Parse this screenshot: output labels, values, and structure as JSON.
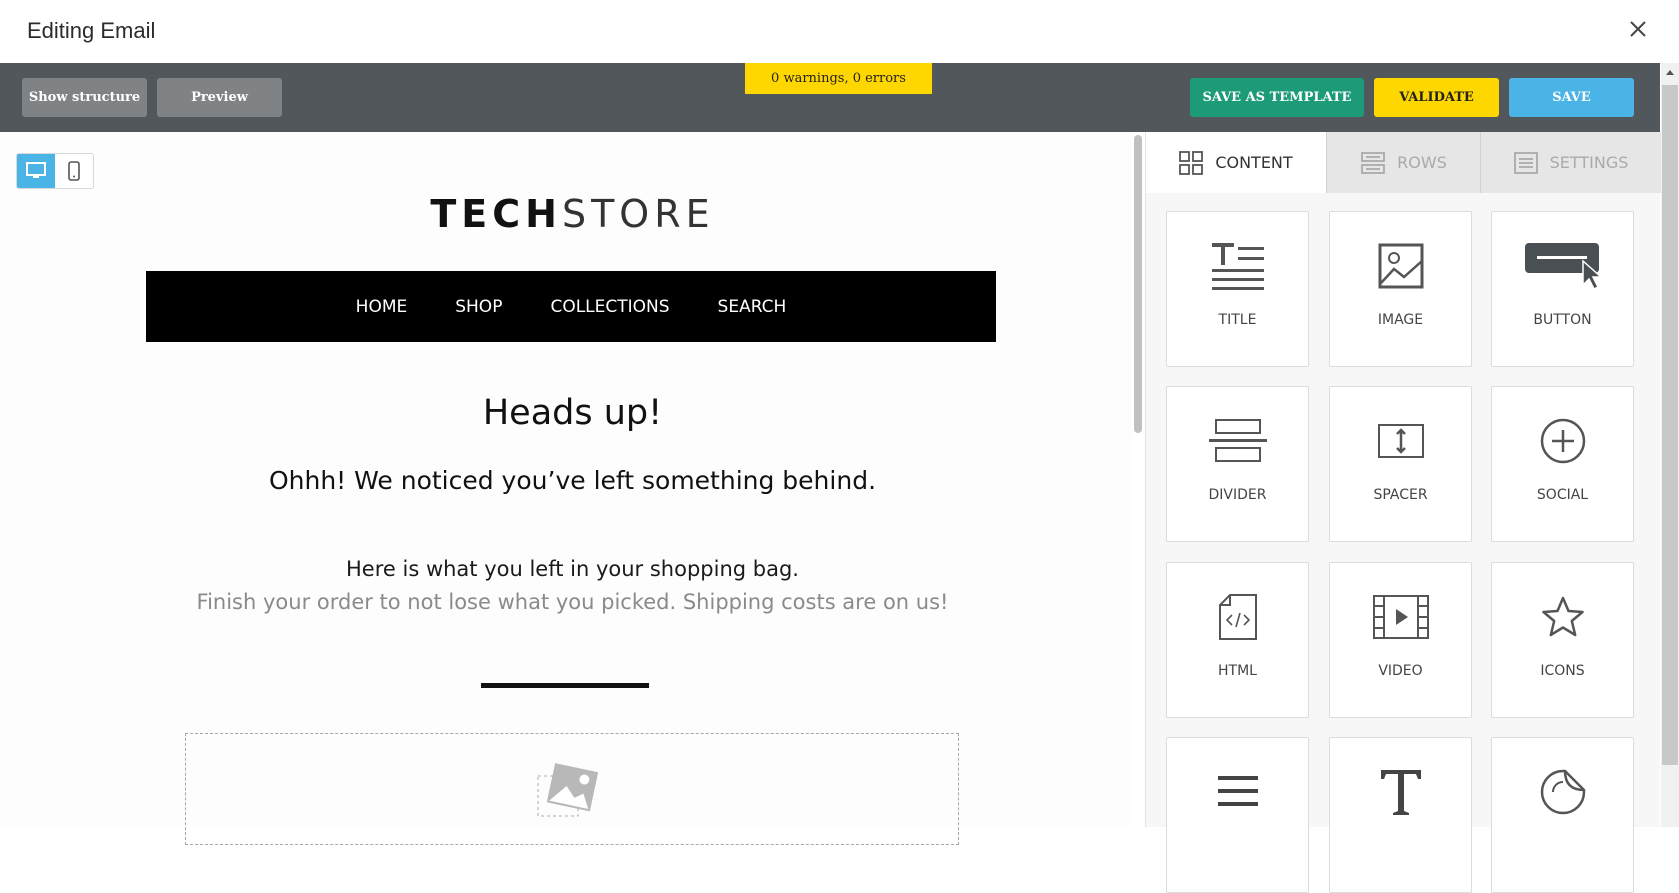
{
  "window": {
    "title": "Editing Email"
  },
  "toolbar": {
    "show_structure": "Show structure",
    "preview": "Preview",
    "status": "0 warnings, 0 errors",
    "save_as_template": "SAVE AS TEMPLATE",
    "validate": "VALIDATE",
    "save": "SAVE",
    "colors": {
      "bar": "#51575a",
      "template": "#1d9b78",
      "validate": "#ffd700",
      "save": "#4ab4e6"
    }
  },
  "email": {
    "logo_bold": "TECH",
    "logo_light": "STORE",
    "nav": [
      "HOME",
      "SHOP",
      "COLLECTIONS",
      "SEARCH"
    ],
    "heading": "Heads up!",
    "subheading": "Ohhh! We noticed you’ve left something behind.",
    "line1": "Here is what you left in your shopping bag.",
    "line2": "Finish your order to not lose what you picked. Shipping costs are on us!"
  },
  "panel": {
    "tabs": [
      {
        "label": "CONTENT",
        "icon": "grid-icon"
      },
      {
        "label": "ROWS",
        "icon": "rows-icon"
      },
      {
        "label": "SETTINGS",
        "icon": "settings-icon"
      }
    ],
    "blocks": [
      {
        "label": "TITLE",
        "icon": "title-icon"
      },
      {
        "label": "IMAGE",
        "icon": "image-icon"
      },
      {
        "label": "BUTTON",
        "icon": "button-icon"
      },
      {
        "label": "DIVIDER",
        "icon": "divider-icon"
      },
      {
        "label": "SPACER",
        "icon": "spacer-icon"
      },
      {
        "label": "SOCIAL",
        "icon": "social-icon"
      },
      {
        "label": "HTML",
        "icon": "html-icon"
      },
      {
        "label": "VIDEO",
        "icon": "video-icon"
      },
      {
        "label": "ICONS",
        "icon": "star-icon"
      },
      {
        "label": "",
        "icon": "menu-icon"
      },
      {
        "label": "",
        "icon": "text-icon"
      },
      {
        "label": "",
        "icon": "sticker-icon"
      }
    ]
  }
}
